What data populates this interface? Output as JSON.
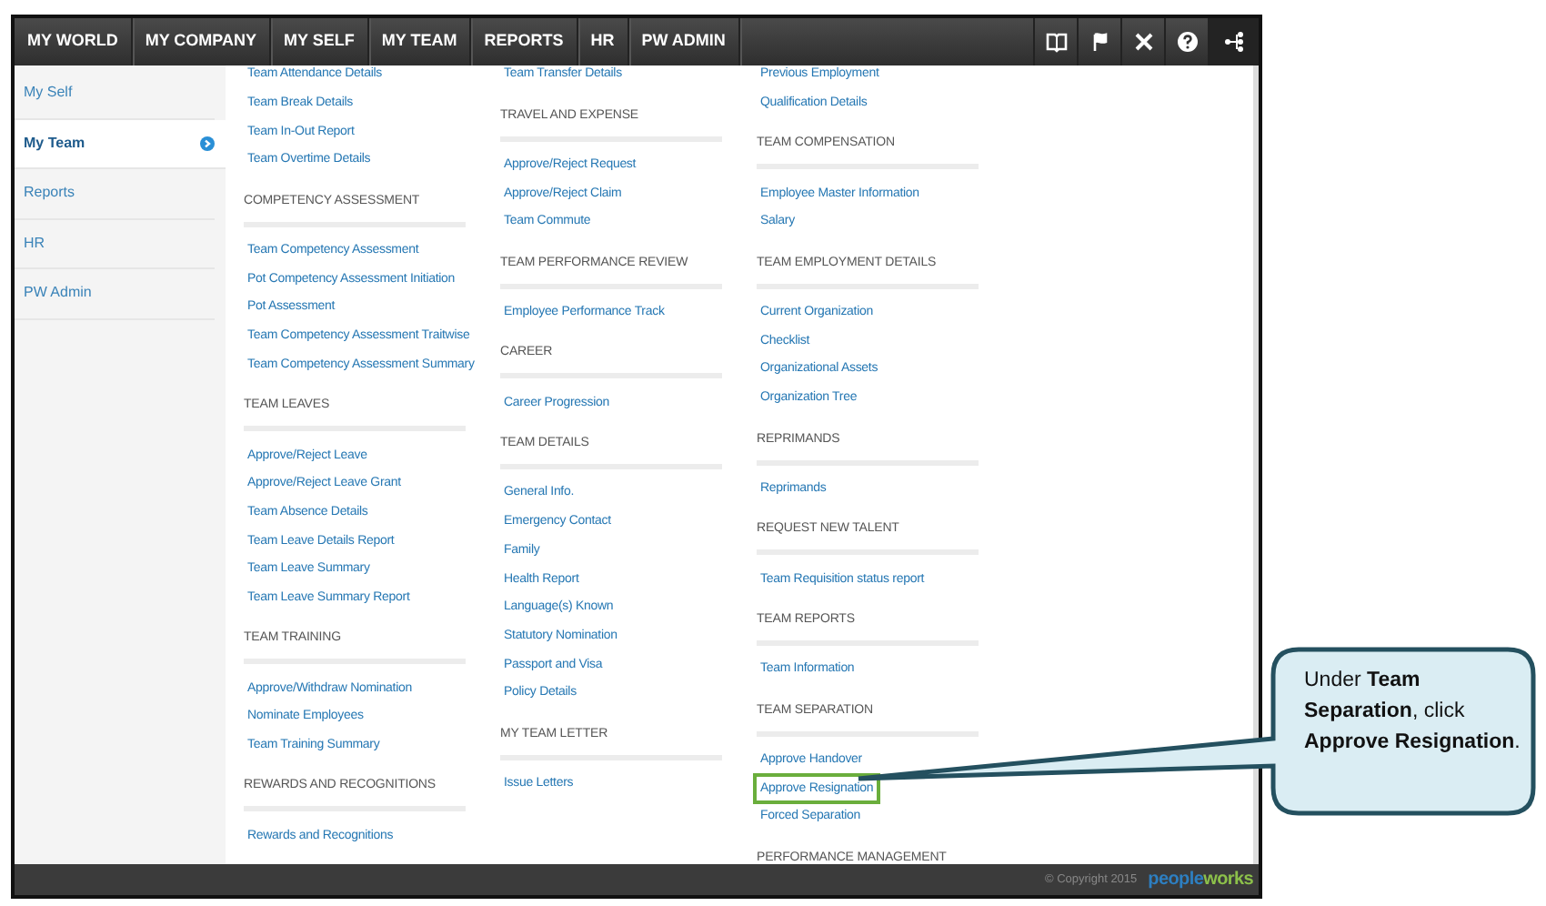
{
  "top_menu": [
    "MY WORLD",
    "MY COMPANY",
    "MY SELF",
    "MY TEAM",
    "REPORTS",
    "HR",
    "PW ADMIN"
  ],
  "sidebar": {
    "items": [
      {
        "label": "My Self",
        "selected": false
      },
      {
        "label": "My Team",
        "selected": true
      },
      {
        "label": "Reports",
        "selected": false
      },
      {
        "label": "HR",
        "selected": false
      },
      {
        "label": "PW Admin",
        "selected": false
      }
    ]
  },
  "columns": [
    [
      {
        "kind": "link",
        "text": "Team Attendance Details"
      },
      {
        "kind": "link",
        "text": "Team Break Details"
      },
      {
        "kind": "link",
        "text": "Team In-Out Report"
      },
      {
        "kind": "link",
        "text": "Team Overtime Details"
      },
      {
        "kind": "heading",
        "text": "COMPETENCY ASSESSMENT"
      },
      {
        "kind": "link",
        "text": "Team Competency Assessment"
      },
      {
        "kind": "link",
        "text": "Pot Competency Assessment Initiation"
      },
      {
        "kind": "link",
        "text": "Pot Assessment"
      },
      {
        "kind": "link",
        "text": "Team Competency Assessment Traitwise"
      },
      {
        "kind": "link",
        "text": "Team Competency Assessment Summary"
      },
      {
        "kind": "heading",
        "text": "TEAM LEAVES"
      },
      {
        "kind": "link",
        "text": "Approve/Reject Leave"
      },
      {
        "kind": "link",
        "text": "Approve/Reject Leave Grant"
      },
      {
        "kind": "link",
        "text": "Team Absence Details"
      },
      {
        "kind": "link",
        "text": "Team Leave Details Report"
      },
      {
        "kind": "link",
        "text": "Team Leave Summary"
      },
      {
        "kind": "link",
        "text": "Team Leave Summary Report"
      },
      {
        "kind": "heading",
        "text": "TEAM TRAINING"
      },
      {
        "kind": "link",
        "text": "Approve/Withdraw Nomination"
      },
      {
        "kind": "link",
        "text": "Nominate Employees"
      },
      {
        "kind": "link",
        "text": "Team Training Summary"
      },
      {
        "kind": "heading",
        "text": "REWARDS AND RECOGNITIONS"
      },
      {
        "kind": "link",
        "text": "Rewards and Recognitions"
      }
    ],
    [
      {
        "kind": "link",
        "text": "Team Transfer Details"
      },
      {
        "kind": "heading",
        "text": "TRAVEL AND EXPENSE"
      },
      {
        "kind": "link",
        "text": "Approve/Reject Request"
      },
      {
        "kind": "link",
        "text": "Approve/Reject Claim"
      },
      {
        "kind": "link",
        "text": "Team Commute"
      },
      {
        "kind": "heading",
        "text": "TEAM PERFORMANCE REVIEW"
      },
      {
        "kind": "link",
        "text": "Employee Performance Track"
      },
      {
        "kind": "heading",
        "text": "CAREER"
      },
      {
        "kind": "link",
        "text": "Career Progression"
      },
      {
        "kind": "heading",
        "text": "TEAM DETAILS"
      },
      {
        "kind": "link",
        "text": "General Info."
      },
      {
        "kind": "link",
        "text": "Emergency Contact"
      },
      {
        "kind": "link",
        "text": "Family"
      },
      {
        "kind": "link",
        "text": "Health Report"
      },
      {
        "kind": "link",
        "text": "Language(s) Known"
      },
      {
        "kind": "link",
        "text": "Statutory Nomination"
      },
      {
        "kind": "link",
        "text": "Passport and Visa"
      },
      {
        "kind": "link",
        "text": "Policy Details"
      },
      {
        "kind": "heading",
        "text": "MY TEAM LETTER"
      },
      {
        "kind": "link",
        "text": "Issue Letters"
      }
    ],
    [
      {
        "kind": "link",
        "text": "Previous Employment"
      },
      {
        "kind": "link",
        "text": "Qualification Details"
      },
      {
        "kind": "heading",
        "text": "TEAM COMPENSATION"
      },
      {
        "kind": "link",
        "text": "Employee Master Information"
      },
      {
        "kind": "link",
        "text": "Salary"
      },
      {
        "kind": "heading",
        "text": "TEAM EMPLOYMENT DETAILS"
      },
      {
        "kind": "link",
        "text": "Current Organization"
      },
      {
        "kind": "link",
        "text": "Checklist"
      },
      {
        "kind": "link",
        "text": "Organizational Assets"
      },
      {
        "kind": "link",
        "text": "Organization Tree"
      },
      {
        "kind": "heading",
        "text": "REPRIMANDS"
      },
      {
        "kind": "link",
        "text": "Reprimands"
      },
      {
        "kind": "heading",
        "text": "REQUEST NEW TALENT"
      },
      {
        "kind": "link",
        "text": "Team Requisition status report"
      },
      {
        "kind": "heading",
        "text": "TEAM REPORTS"
      },
      {
        "kind": "link",
        "text": "Team Information"
      },
      {
        "kind": "heading",
        "text": "TEAM SEPARATION"
      },
      {
        "kind": "link",
        "text": "Approve Handover"
      },
      {
        "kind": "link",
        "text": "Approve Resignation",
        "highlighted": true
      },
      {
        "kind": "link",
        "text": "Forced Separation"
      },
      {
        "kind": "heading",
        "text": "PERFORMANCE MANAGEMENT"
      }
    ]
  ],
  "footer": {
    "copyright": "© Copyright 2015",
    "logo": [
      "people",
      "works"
    ]
  },
  "callout": "Under **Team Separation**, click **Approve Resignation**."
}
